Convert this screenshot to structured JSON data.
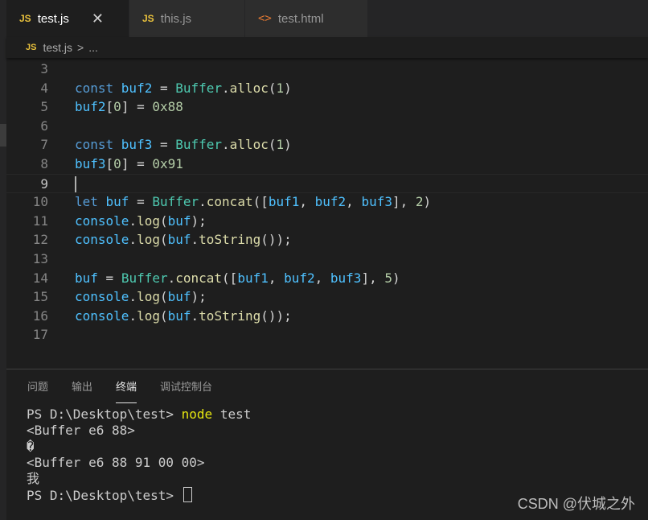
{
  "tabs": [
    {
      "icon": "JS",
      "label": "test.js",
      "close": "✕"
    },
    {
      "icon": "JS",
      "label": "this.js"
    },
    {
      "icon": "<>",
      "label": "test.html"
    }
  ],
  "breadcrumb": {
    "icon": "JS",
    "file": "test.js",
    "separator": ">",
    "more": "..."
  },
  "editor": {
    "current_line": "9",
    "lines": [
      {
        "n": "3"
      },
      {
        "n": "4",
        "t": [
          "const",
          "buf2",
          "=",
          "Buffer",
          ".",
          "alloc",
          "(",
          "1",
          ")"
        ]
      },
      {
        "n": "5",
        "t": [
          "buf2",
          "[",
          "0",
          "] = ",
          "0x88"
        ]
      },
      {
        "n": "6"
      },
      {
        "n": "7",
        "t": [
          "const",
          "buf3",
          "=",
          "Buffer",
          ".",
          "alloc",
          "(",
          "1",
          ")"
        ]
      },
      {
        "n": "8",
        "t": [
          "buf3",
          "[",
          "0",
          "] = ",
          "0x91"
        ]
      },
      {
        "n": "9"
      },
      {
        "n": "10",
        "t": [
          "let",
          "buf",
          "=",
          "Buffer",
          ".",
          "concat",
          "([",
          "buf1",
          ", ",
          "buf2",
          ", ",
          "buf3",
          "], ",
          "2",
          ")"
        ]
      },
      {
        "n": "11",
        "t": [
          "console",
          ".",
          "log",
          "(",
          "buf",
          ");"
        ]
      },
      {
        "n": "12",
        "t": [
          "console",
          ".",
          "log",
          "(",
          "buf",
          ".",
          "toString",
          "());"
        ]
      },
      {
        "n": "13"
      },
      {
        "n": "14",
        "t": [
          "buf",
          "=",
          "Buffer",
          ".",
          "concat",
          "([",
          "buf1",
          ", ",
          "buf2",
          ", ",
          "buf3",
          "], ",
          "5",
          ")"
        ]
      },
      {
        "n": "15",
        "t": [
          "console",
          ".",
          "log",
          "(",
          "buf",
          ");"
        ]
      },
      {
        "n": "16",
        "t": [
          "console",
          ".",
          "log",
          "(",
          "buf",
          ".",
          "toString",
          "());"
        ]
      },
      {
        "n": "17"
      }
    ]
  },
  "panel": {
    "tabs": [
      "问题",
      "输出",
      "终端",
      "调试控制台"
    ],
    "active_tab": "终端"
  },
  "terminal": {
    "prompt": "PS D:\\Desktop\\test> ",
    "command_name": "node",
    "command_arg": " test",
    "output": [
      "<Buffer e6 88>",
      "�",
      "<Buffer e6 88 91 00 00>",
      "我"
    ]
  },
  "watermark": "CSDN @伏城之外",
  "colors": {
    "keyword": "#569cd6",
    "variable": "#4fc1ff",
    "class": "#4ec9b0",
    "function": "#dcdcaa",
    "number": "#b5cea8",
    "js_icon": "#e8c13c",
    "html_icon": "#e37933",
    "terminal_command": "#e5e510"
  }
}
